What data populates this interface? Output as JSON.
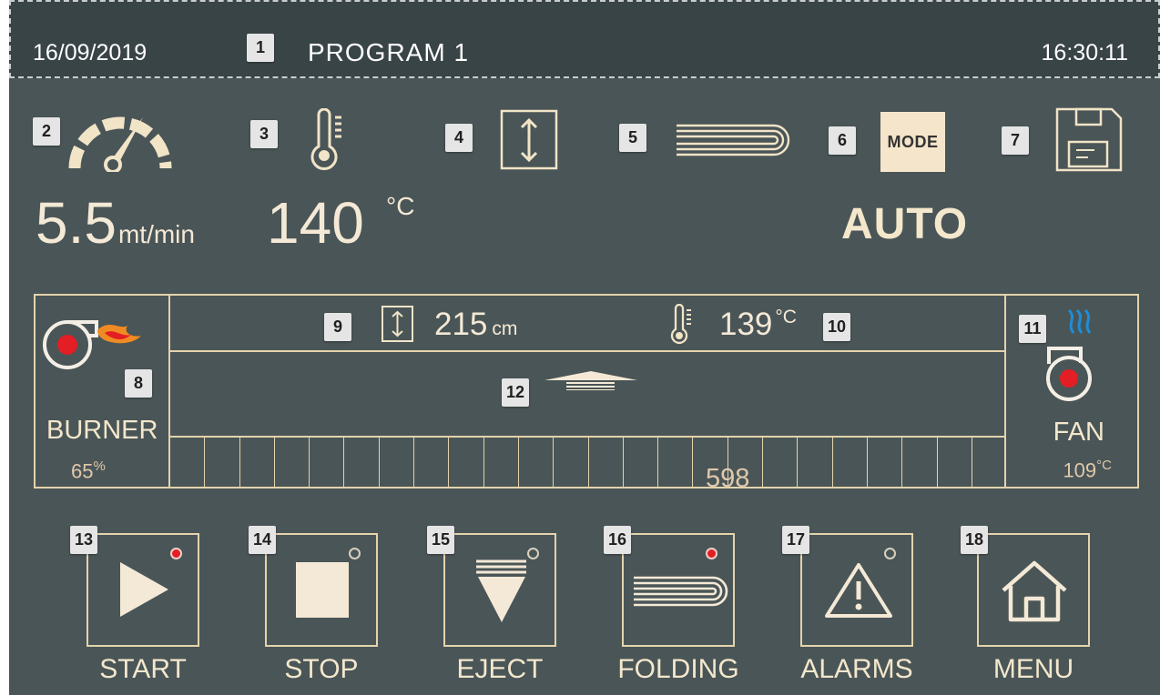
{
  "header": {
    "date": "16/09/2019",
    "program_label": "PROGRAM 1",
    "time": "16:30:11"
  },
  "markers": [
    "1",
    "2",
    "3",
    "4",
    "5",
    "6",
    "7",
    "8",
    "9",
    "10",
    "11",
    "12",
    "13",
    "14",
    "15",
    "16",
    "17",
    "18"
  ],
  "status": {
    "speed_value": "5.5",
    "speed_unit": "mt/min",
    "temperature_value": "140",
    "temperature_unit": "°C",
    "mode_label": "MODE",
    "mode_value": "AUTO"
  },
  "machine": {
    "burner_label": "BURNER",
    "burner_percent": "65",
    "burner_percent_unit": "%",
    "fan_label": "FAN",
    "fan_temperature": "109",
    "fan_temperature_unit": "°C",
    "height_value": "215",
    "height_unit": "cm",
    "temperature_value": "139",
    "temperature_unit": "°C",
    "piece_count": "598"
  },
  "buttons": [
    {
      "label": "START",
      "active": true
    },
    {
      "label": "STOP",
      "active": false
    },
    {
      "label": "EJECT",
      "active": false
    },
    {
      "label": "FOLDING",
      "active": true
    },
    {
      "label": "ALARMS",
      "active": false
    },
    {
      "label": "MENU",
      "active": false
    }
  ],
  "colors": {
    "screen_background": "#4a5557",
    "header_background": "#394447",
    "accent": "#f3e7cc",
    "active_led": "#e31e24",
    "burner_flame": "#f08b24",
    "fan_waves": "#1d8ed8"
  },
  "icons": [
    "speedometer-icon",
    "thermometer-icon",
    "height-icon",
    "folding-layers-icon",
    "mode-icon",
    "save-disk-icon",
    "burner-icon",
    "fan-icon",
    "conveyor-arrow-icon",
    "play-icon",
    "stop-icon",
    "eject-icon",
    "folding-icon",
    "alarm-icon",
    "home-icon"
  ]
}
